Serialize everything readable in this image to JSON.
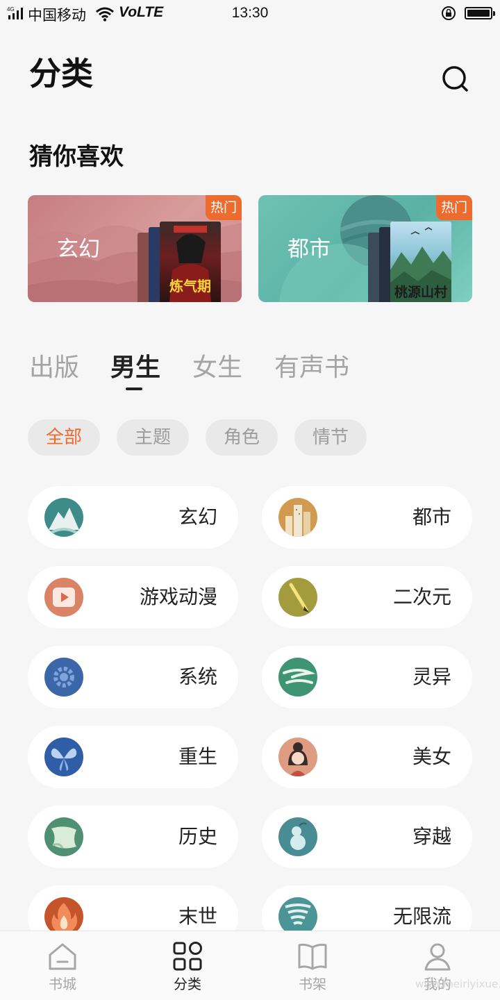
{
  "status_bar": {
    "network_type": "4G",
    "carrier": "中国移动",
    "volte": "VoLTE",
    "time": "13:30"
  },
  "header": {
    "title": "分类"
  },
  "recommend": {
    "title": "猜你喜欢",
    "cards": [
      {
        "label": "玄幻",
        "badge": "热门",
        "cover_text": "炼气期"
      },
      {
        "label": "都市",
        "badge": "热门",
        "cover_text": "桃源山村"
      }
    ]
  },
  "tabs": [
    {
      "label": "出版",
      "active": false
    },
    {
      "label": "男生",
      "active": true
    },
    {
      "label": "女生",
      "active": false
    },
    {
      "label": "有声书",
      "active": false
    }
  ],
  "filters": [
    {
      "label": "全部",
      "active": true
    },
    {
      "label": "主题",
      "active": false
    },
    {
      "label": "角色",
      "active": false
    },
    {
      "label": "情节",
      "active": false
    }
  ],
  "categories": [
    {
      "label": "玄幻",
      "icon": "mountain-icon",
      "color": "#3e8c8a"
    },
    {
      "label": "都市",
      "icon": "city-buildings-icon",
      "color": "#d19a4e"
    },
    {
      "label": "游戏动漫",
      "icon": "play-button-icon",
      "color": "#d98467"
    },
    {
      "label": "二次元",
      "icon": "brush-icon",
      "color": "#a49a3e"
    },
    {
      "label": "系统",
      "icon": "gear-icon",
      "color": "#3b66a7"
    },
    {
      "label": "灵异",
      "icon": "wind-icon",
      "color": "#3f9474"
    },
    {
      "label": "重生",
      "icon": "butterfly-icon",
      "color": "#2f5ea6"
    },
    {
      "label": "美女",
      "icon": "girl-face-icon",
      "color": "#de9c80"
    },
    {
      "label": "历史",
      "icon": "scroll-icon",
      "color": "#4f9072"
    },
    {
      "label": "穿越",
      "icon": "gourd-icon",
      "color": "#4a8c94"
    },
    {
      "label": "末世",
      "icon": "fire-icon",
      "color": "#c4542a"
    },
    {
      "label": "无限流",
      "icon": "tornado-icon",
      "color": "#4b9596"
    }
  ],
  "bottom_nav": [
    {
      "label": "书城",
      "icon": "home-icon",
      "active": false
    },
    {
      "label": "分类",
      "icon": "category-grid-icon",
      "active": true
    },
    {
      "label": "书架",
      "icon": "book-icon",
      "active": false
    },
    {
      "label": "我的",
      "icon": "user-icon",
      "active": false
    }
  ],
  "watermark": "www.meiriyixue.cn",
  "colors": {
    "accent": "#ef6a2d",
    "text_primary": "#222222",
    "text_inactive": "#a4a4a4",
    "background": "#f6f6f6"
  }
}
